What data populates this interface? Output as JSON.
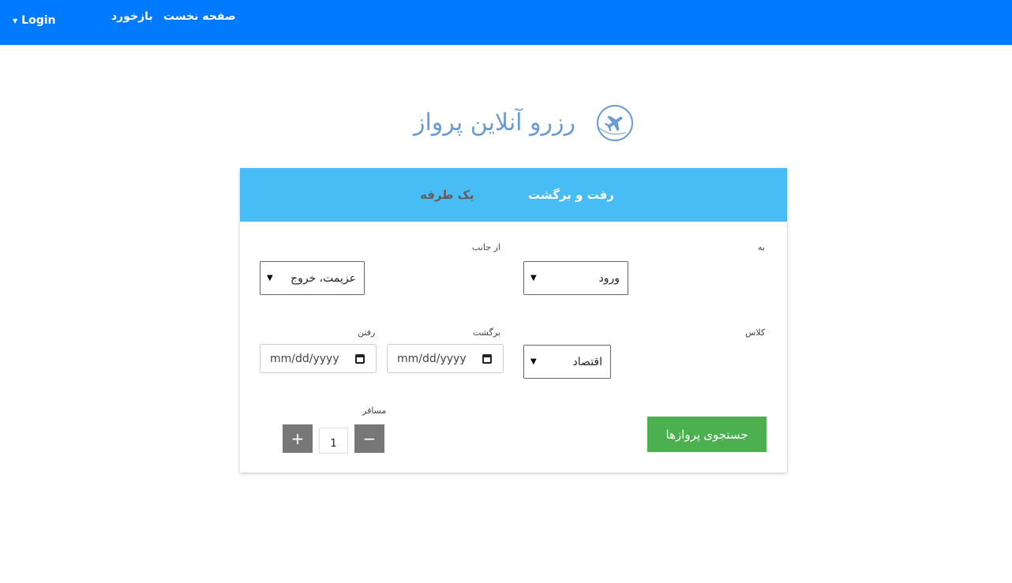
{
  "nav": {
    "login": "Login",
    "home": "صفحه نخست",
    "feedback": "بازخورد"
  },
  "hero": {
    "title": "رزرو آنلاین پرواز",
    "icon": "airplane-circle-icon"
  },
  "tabs": {
    "round_trip": "رفت و برگشت",
    "one_way": "یک طرفه"
  },
  "form": {
    "to_label": "به",
    "to_value": "ورود",
    "from_label": "از جانب",
    "from_value": "عزیمت، خروج",
    "class_label": "کلاس",
    "class_value": "اقتصاد",
    "return_label": "برگشت",
    "return_value": "mm/dd/yyyy",
    "depart_label": "رفتن",
    "depart_value": "mm/dd/yyyy",
    "passenger_label": "مسافر",
    "passenger_count": "1",
    "minus": "−",
    "plus": "+",
    "search_button": "جستجوی پروازها"
  },
  "colors": {
    "navbar": "#007bff",
    "tab_bar": "#48bdf5",
    "search_button": "#4caf50",
    "title": "#6a9bd3"
  }
}
